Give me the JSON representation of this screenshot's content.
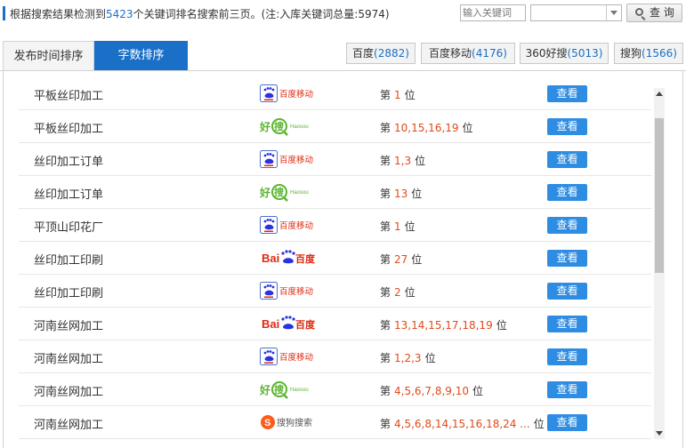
{
  "summary": {
    "prefix": "根据搜索结果检测到",
    "count": "5423",
    "suffix": "个关键词排名搜索前三页。(注:入库关键词总量:5974)"
  },
  "search": {
    "placeholder": "输入关键词",
    "query_label": "查 询"
  },
  "sort_tabs": [
    "发布时间排序",
    "字数排序"
  ],
  "engine_tabs": [
    {
      "name": "百度",
      "count": "(2882)"
    },
    {
      "name": "百度移动",
      "count": "(4176)"
    },
    {
      "name": "360好搜",
      "count": "(5013)"
    },
    {
      "name": "搜狗",
      "count": "(1566)"
    }
  ],
  "rank_prefix": "第",
  "rank_suffix": "位",
  "view_label": "查看",
  "logo_text": {
    "baidu_bai": "Bai",
    "baidu_du": "百度",
    "baidu_mobile": "百度移动",
    "haosou_cn": "好",
    "haosou_sou": "搜",
    "haosou_en": "Haosou",
    "sogou": "搜狗搜索"
  },
  "rows": [
    {
      "keyword": "平板丝印加工",
      "engine": "baidu-mobile",
      "positions": "1"
    },
    {
      "keyword": "平板丝印加工",
      "engine": "haosou",
      "positions": "10,15,16,19"
    },
    {
      "keyword": "丝印加工订单",
      "engine": "baidu-mobile",
      "positions": "1,3"
    },
    {
      "keyword": "丝印加工订单",
      "engine": "haosou",
      "positions": "13"
    },
    {
      "keyword": "平顶山印花厂",
      "engine": "baidu-mobile",
      "positions": "1"
    },
    {
      "keyword": "丝印加工印刷",
      "engine": "baidu",
      "positions": "27"
    },
    {
      "keyword": "丝印加工印刷",
      "engine": "baidu-mobile",
      "positions": "2"
    },
    {
      "keyword": "河南丝网加工",
      "engine": "baidu",
      "positions": "13,14,15,17,18,19"
    },
    {
      "keyword": "河南丝网加工",
      "engine": "baidu-mobile",
      "positions": "1,2,3"
    },
    {
      "keyword": "河南丝网加工",
      "engine": "haosou",
      "positions": "4,5,6,7,8,9,10"
    },
    {
      "keyword": "河南丝网加工",
      "engine": "sogou",
      "positions": "4,5,6,8,14,15,16,18,24 ..."
    }
  ],
  "colors": {
    "accent_blue": "#1a6fc7",
    "button_blue": "#2e8de2",
    "rank_red": "#e04a1a",
    "haosou_green": "#5cb531",
    "baidu_red": "#de2910"
  }
}
